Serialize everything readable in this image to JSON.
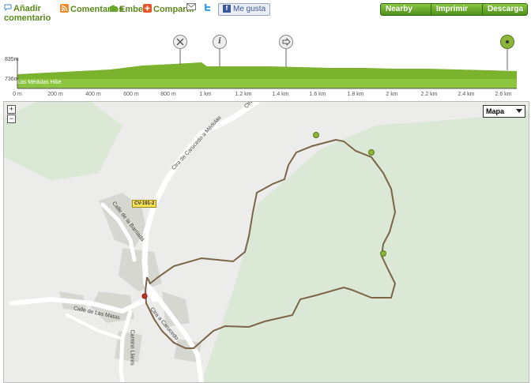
{
  "toolbar": {
    "add_comment_line1": "Añadir",
    "add_comment_line2": "comentario",
    "comments": "Comentarios",
    "embed": "Embed",
    "share": "Compartir",
    "like": "Me gusta",
    "nearby": "Nearby",
    "print": "Imprimir",
    "download": "Descarga"
  },
  "profile": {
    "y_max_label": "835m",
    "y_min_label": "736m",
    "track_name": "Las Médulas Hike",
    "x_ticks": [
      "0 m",
      "200 m",
      "400 m",
      "600 m",
      "800 m",
      "1 km",
      "1.2 km",
      "1.4 km",
      "1.6 km",
      "1.8 km",
      "2 km",
      "2.2 km",
      "2.4 km",
      "2.6 km"
    ],
    "waypoint_icons": [
      "hammer-pick-icon",
      "info-icon",
      "arrow-right-icon",
      "end-point-icon"
    ]
  },
  "map": {
    "zoom_in": "+",
    "zoom_out": "−",
    "map_type": "Mapa",
    "road_badge": "CV-191-2",
    "streets": [
      {
        "text": "Ctra de Carucedo a Médulas"
      },
      {
        "text": "Calle de la Barriada"
      },
      {
        "text": "Calle de Las Matas"
      },
      {
        "text": "Camino Llares"
      },
      {
        "text": "Ctra a Carucedo"
      },
      {
        "text": "Ctra"
      }
    ]
  },
  "colors": {
    "accent_green": "#5a8a1a",
    "profile_fill": "#7bb22e",
    "forest": "#dbe8d5",
    "trail": "#7a6548",
    "waypoint": "#8cb53a",
    "start_marker": "#c0392b"
  }
}
